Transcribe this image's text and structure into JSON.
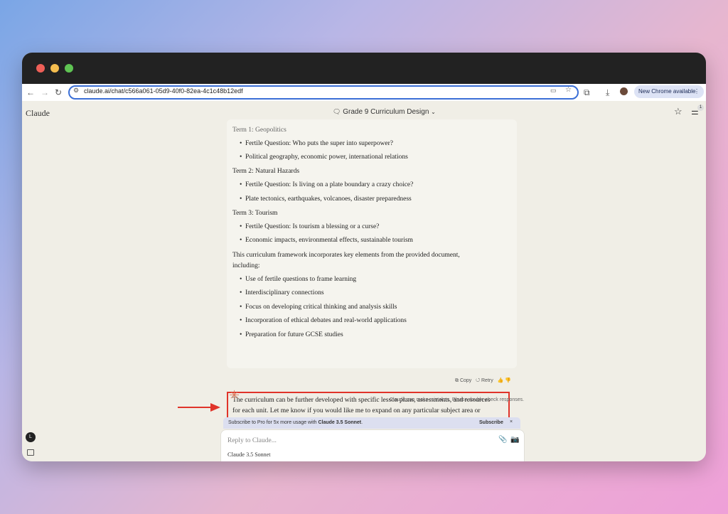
{
  "browser": {
    "url": "claude.ai/chat/c566a061-05d9-40f0-82ea-4c1c48b12edf",
    "update_button": "New Chrome available"
  },
  "app": {
    "brand": "Claude",
    "chat_title": "Grade 9 Curriculum Design",
    "notification_count": "1",
    "user_initial": "L"
  },
  "message": {
    "lines": [
      {
        "kind": "heading",
        "text": "Term 1: Geopolitics"
      },
      {
        "kind": "bullet",
        "text": "Fertile Question: Who puts the super into superpower?"
      },
      {
        "kind": "bullet",
        "text": "Political geography, economic power, international relations"
      },
      {
        "kind": "heading",
        "text": "Term 2: Natural Hazards"
      },
      {
        "kind": "bullet",
        "text": "Fertile Question: Is living on a plate boundary a crazy choice?"
      },
      {
        "kind": "bullet",
        "text": "Plate tectonics, earthquakes, volcanoes, disaster preparedness"
      },
      {
        "kind": "heading",
        "text": "Term 3: Tourism"
      },
      {
        "kind": "bullet",
        "text": "Fertile Question: Is tourism a blessing or a curse?"
      },
      {
        "kind": "bullet",
        "text": "Economic impacts, environmental effects, sustainable tourism"
      },
      {
        "kind": "para",
        "text": "This curriculum framework incorporates key elements from the provided document,"
      },
      {
        "kind": "para",
        "text": "including:"
      },
      {
        "kind": "bullet",
        "text": "Use of fertile questions to frame learning"
      },
      {
        "kind": "bullet",
        "text": "Interdisciplinary connections"
      },
      {
        "kind": "bullet",
        "text": "Focus on developing critical thinking and analysis skills"
      },
      {
        "kind": "bullet",
        "text": "Incorporation of ethical debates and real-world applications"
      },
      {
        "kind": "bullet",
        "text": "Preparation for future GCSE studies"
      }
    ],
    "closing": "The curriculum can be further developed with specific lesson plans, assessments, and resources for each unit. Let me know if you would like me to expand on any particular subject area or element of the curriculum."
  },
  "actions": {
    "copy": "Copy",
    "retry": "Retry"
  },
  "disclaimer": "Claude can make mistakes. Please double-check responses.",
  "promo": {
    "text_prefix": "Subscribe to Pro for 5x more usage with ",
    "model": "Claude 3.5 Sonnet",
    "text_suffix": ".",
    "button": "Subscribe"
  },
  "composer": {
    "placeholder": "Reply to Claude...",
    "model_name": "Claude",
    "model_version": "3.5 Sonnet"
  },
  "colors": {
    "highlight": "#e0342a",
    "accent": "#d9775a"
  }
}
